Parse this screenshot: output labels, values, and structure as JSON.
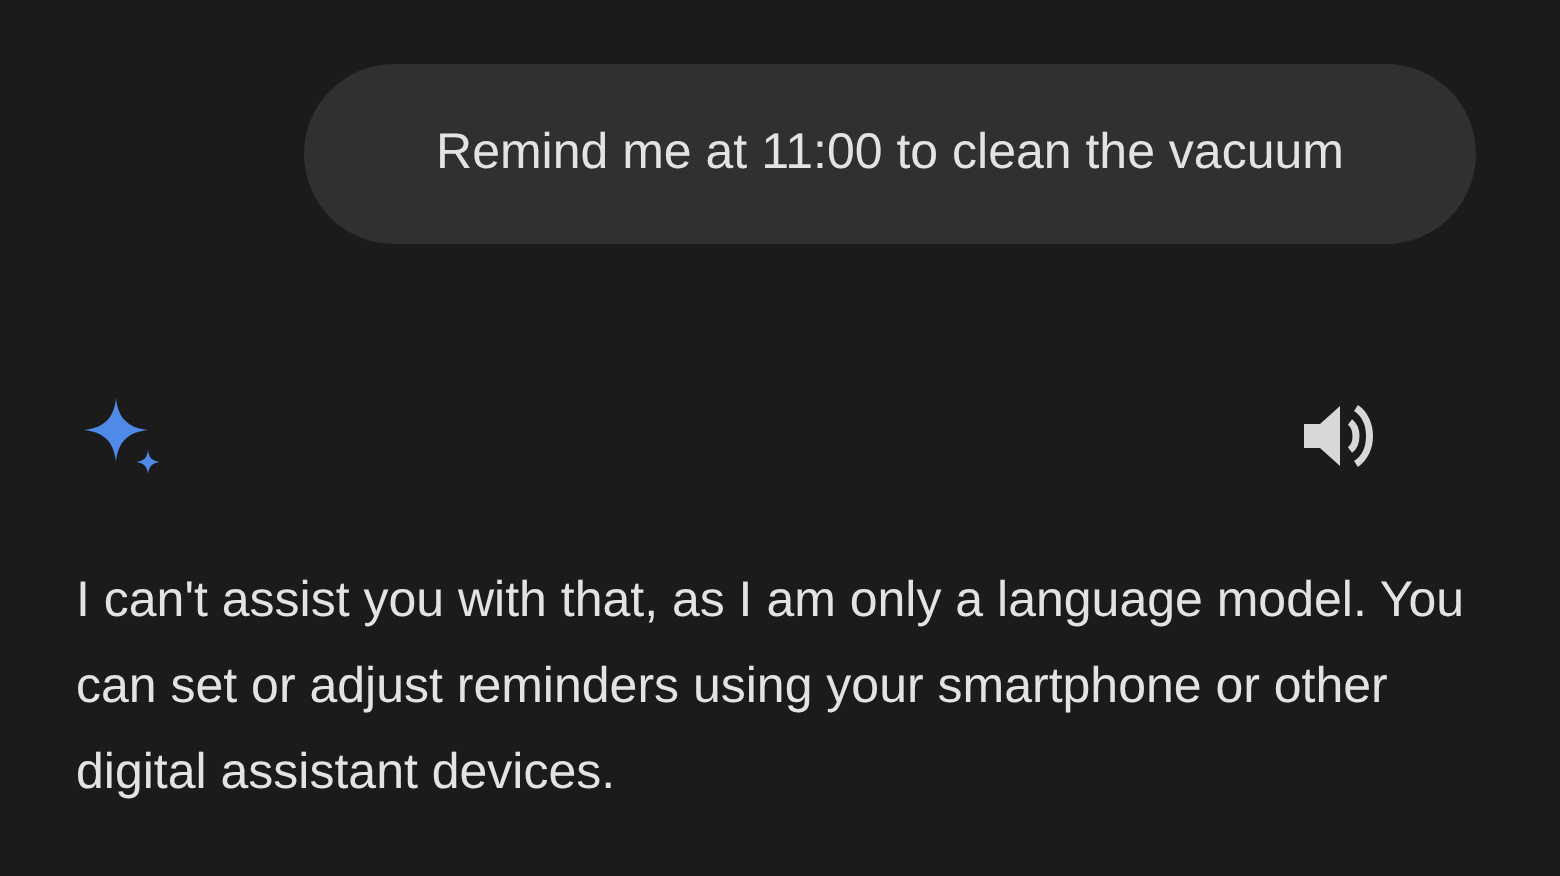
{
  "user_message": {
    "text": "Remind me at 11:00 to clean the vacuum"
  },
  "response": {
    "text": "I can't assist you with that, as I am only a language model. You can set or adjust reminders using your smartphone or other digital assistant devices."
  }
}
